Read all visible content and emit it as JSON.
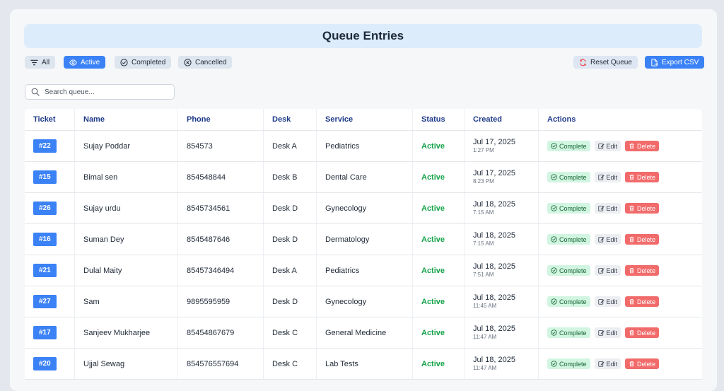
{
  "header": {
    "title": "Queue Entries"
  },
  "filters": {
    "all": "All",
    "active": "Active",
    "completed": "Completed",
    "cancelled": "Cancelled",
    "selected": "Active"
  },
  "toolbar": {
    "reset": "Reset Queue",
    "export": "Export CSV"
  },
  "search": {
    "placeholder": "Search queue..."
  },
  "table": {
    "columns": [
      "Ticket",
      "Name",
      "Phone",
      "Desk",
      "Service",
      "Status",
      "Created",
      "Actions"
    ],
    "action_labels": {
      "complete": "Complete",
      "edit": "Edit",
      "delete": "Delete"
    },
    "rows": [
      {
        "ticket": "#22",
        "name": "Sujay Poddar",
        "phone": "854573",
        "desk": "Desk A",
        "service": "Pediatrics",
        "status": "Active",
        "date": "Jul 17, 2025",
        "time": "1:27 PM"
      },
      {
        "ticket": "#15",
        "name": "Bimal sen",
        "phone": "854548844",
        "desk": "Desk B",
        "service": "Dental Care",
        "status": "Active",
        "date": "Jul 17, 2025",
        "time": "8:23 PM"
      },
      {
        "ticket": "#26",
        "name": "Sujay urdu",
        "phone": "8545734561",
        "desk": "Desk D",
        "service": "Gynecology",
        "status": "Active",
        "date": "Jul 18, 2025",
        "time": "7:15 AM"
      },
      {
        "ticket": "#16",
        "name": "Suman Dey",
        "phone": "8545487646",
        "desk": "Desk D",
        "service": "Dermatology",
        "status": "Active",
        "date": "Jul 18, 2025",
        "time": "7:15 AM"
      },
      {
        "ticket": "#21",
        "name": "Dulal Maity",
        "phone": "85457346494",
        "desk": "Desk A",
        "service": "Pediatrics",
        "status": "Active",
        "date": "Jul 18, 2025",
        "time": "7:51 AM"
      },
      {
        "ticket": "#27",
        "name": "Sam",
        "phone": "9895595959",
        "desk": "Desk D",
        "service": "Gynecology",
        "status": "Active",
        "date": "Jul 18, 2025",
        "time": "11:45 AM"
      },
      {
        "ticket": "#17",
        "name": "Sanjeev Mukharjee",
        "phone": "85454867679",
        "desk": "Desk C",
        "service": "General Medicine",
        "status": "Active",
        "date": "Jul 18, 2025",
        "time": "11:47 AM"
      },
      {
        "ticket": "#20",
        "name": "Ujjal Sewag",
        "phone": "854576557694",
        "desk": "Desk C",
        "service": "Lab Tests",
        "status": "Active",
        "date": "Jul 18, 2025",
        "time": "11:47 AM"
      }
    ]
  }
}
